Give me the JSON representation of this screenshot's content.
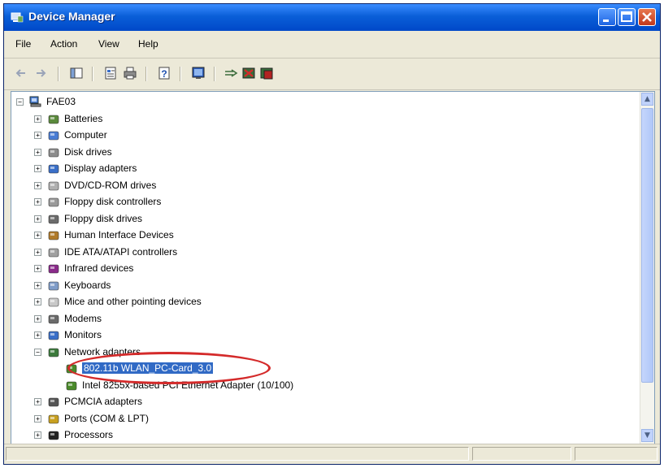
{
  "window": {
    "title": "Device Manager"
  },
  "menu": {
    "file": "File",
    "action": "Action",
    "view": "View",
    "help": "Help"
  },
  "toolbar_icons": [
    "back-arrow-icon",
    "forward-arrow-icon",
    "show-hide-tree-icon",
    "properties-icon",
    "print-icon",
    "help-icon",
    "update-driver-icon",
    "scan-hardware-icon",
    "uninstall-icon",
    "disable-icon"
  ],
  "tree": {
    "root": "FAE03",
    "items": [
      {
        "label": "Batteries",
        "icon": "battery-icon"
      },
      {
        "label": "Computer",
        "icon": "computer-icon"
      },
      {
        "label": "Disk drives",
        "icon": "disk-drive-icon"
      },
      {
        "label": "Display adapters",
        "icon": "display-adapter-icon"
      },
      {
        "label": "DVD/CD-ROM drives",
        "icon": "cdrom-icon"
      },
      {
        "label": "Floppy disk controllers",
        "icon": "controller-icon"
      },
      {
        "label": "Floppy disk drives",
        "icon": "floppy-drive-icon"
      },
      {
        "label": "Human Interface Devices",
        "icon": "hid-icon"
      },
      {
        "label": "IDE ATA/ATAPI controllers",
        "icon": "ide-controller-icon"
      },
      {
        "label": "Infrared devices",
        "icon": "infrared-icon"
      },
      {
        "label": "Keyboards",
        "icon": "keyboard-icon"
      },
      {
        "label": "Mice and other pointing devices",
        "icon": "mouse-icon"
      },
      {
        "label": "Modems",
        "icon": "modem-icon"
      },
      {
        "label": "Monitors",
        "icon": "monitor-icon"
      },
      {
        "label": "Network adapters",
        "icon": "network-adapter-icon",
        "expanded": true
      },
      {
        "label": "802.11b WLAN_PC-Card_3.0",
        "icon": "network-card-icon",
        "child": true,
        "selected": true
      },
      {
        "label": "Intel 8255x-based PCI Ethernet Adapter (10/100)",
        "icon": "network-card-icon",
        "child": true
      },
      {
        "label": "PCMCIA adapters",
        "icon": "pcmcia-icon"
      },
      {
        "label": "Ports (COM & LPT)",
        "icon": "port-icon"
      },
      {
        "label": "Processors",
        "icon": "processor-icon"
      }
    ]
  },
  "colors": {
    "title_bar": "#0a5fd8",
    "selection": "#316ac5",
    "annotation": "#d42a2a"
  }
}
